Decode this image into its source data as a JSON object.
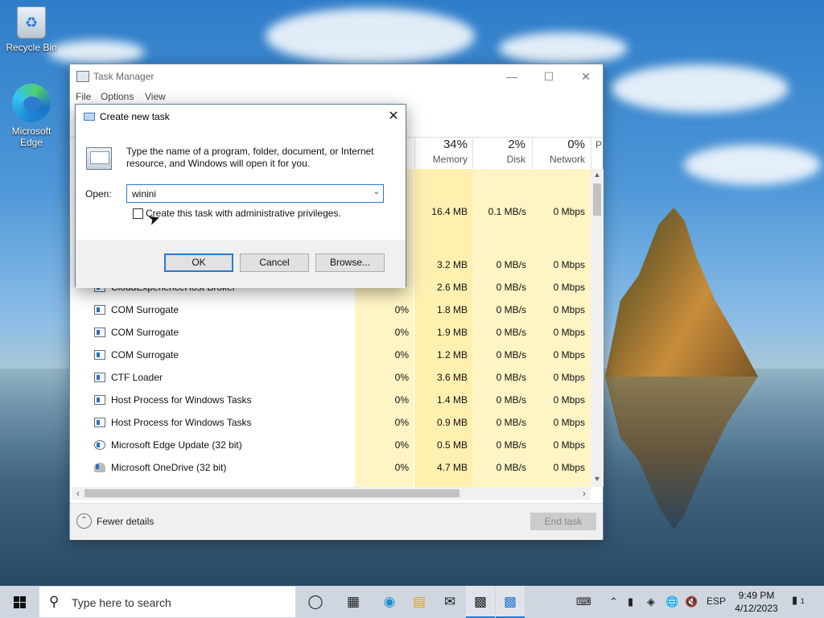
{
  "desktop": {
    "icons": [
      {
        "label": "Recycle Bin"
      },
      {
        "label": "Microsoft Edge"
      }
    ]
  },
  "task_manager": {
    "title": "Task Manager",
    "menu": [
      "File",
      "Options",
      "View"
    ],
    "columns": [
      {
        "pct": "34%",
        "label": "Memory"
      },
      {
        "pct": "2%",
        "label": "Disk"
      },
      {
        "pct": "0%",
        "label": "Network"
      },
      {
        "pct": "",
        "label": "P"
      }
    ],
    "rows": [
      {
        "name": "",
        "cpu": "",
        "mem": "16.4 MB",
        "disk": "0.1 MB/s",
        "net": "0 Mbps"
      },
      {
        "name": "",
        "cpu": "",
        "mem": "3.2 MB",
        "disk": "0 MB/s",
        "net": "0 Mbps"
      },
      {
        "name": "CloudExperienceHost Broker",
        "cpu": "",
        "mem": "2.6 MB",
        "disk": "0 MB/s",
        "net": "0 Mbps"
      },
      {
        "name": "COM Surrogate",
        "cpu": "0%",
        "mem": "1.8 MB",
        "disk": "0 MB/s",
        "net": "0 Mbps"
      },
      {
        "name": "COM Surrogate",
        "cpu": "0%",
        "mem": "1.9 MB",
        "disk": "0 MB/s",
        "net": "0 Mbps"
      },
      {
        "name": "COM Surrogate",
        "cpu": "0%",
        "mem": "1.2 MB",
        "disk": "0 MB/s",
        "net": "0 Mbps"
      },
      {
        "name": "CTF Loader",
        "cpu": "0%",
        "mem": "3.6 MB",
        "disk": "0 MB/s",
        "net": "0 Mbps"
      },
      {
        "name": "Host Process for Windows Tasks",
        "cpu": "0%",
        "mem": "1.4 MB",
        "disk": "0 MB/s",
        "net": "0 Mbps"
      },
      {
        "name": "Host Process for Windows Tasks",
        "cpu": "0%",
        "mem": "0.9 MB",
        "disk": "0 MB/s",
        "net": "0 Mbps"
      },
      {
        "name": "Microsoft Edge Update (32 bit)",
        "cpu": "0%",
        "mem": "0.5 MB",
        "disk": "0 MB/s",
        "net": "0 Mbps"
      },
      {
        "name": "Microsoft OneDrive (32 bit)",
        "cpu": "0%",
        "mem": "4.7 MB",
        "disk": "0 MB/s",
        "net": "0 Mbps"
      }
    ],
    "footer": {
      "fewer_details": "Fewer details",
      "end_task": "End task"
    }
  },
  "run_dialog": {
    "title": "Create new task",
    "description": "Type the name of a program, folder, document, or Internet resource, and Windows will open it for you.",
    "open_label": "Open:",
    "open_value": "winini",
    "admin_checkbox_label": "Create this task with administrative privileges.",
    "admin_checked": false,
    "buttons": {
      "ok": "OK",
      "cancel": "Cancel",
      "browse": "Browse..."
    }
  },
  "taskbar": {
    "search_placeholder": "Type here to search",
    "language": "ESP",
    "time": "9:49 PM",
    "date": "4/12/2023",
    "notification_count": "1"
  }
}
